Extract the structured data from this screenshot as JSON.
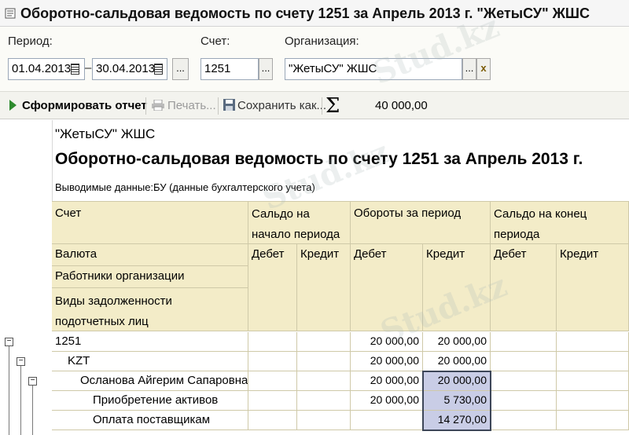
{
  "window": {
    "title": "Оборотно-сальдовая ведомость по счету 1251 за Апрель 2013 г. \"ЖетыСУ\" ЖШС"
  },
  "params": {
    "period_label": "Период:",
    "date_from": "01.04.2013",
    "dash": "–",
    "date_to": "30.04.2013",
    "ellipsis": "...",
    "account_label": "Счет:",
    "account": "1251",
    "org_label": "Организация:",
    "org": "\"ЖетыСУ\" ЖШС",
    "clear": "x"
  },
  "toolbar": {
    "generate": "Сформировать отчет",
    "print": "Печать...",
    "save": "Сохранить как...",
    "sigma": "Σ",
    "sum": "40 000,00"
  },
  "report": {
    "org": "\"ЖетыСУ\" ЖШС",
    "title": "Оборотно-сальдовая ведомость по счету 1251 за Апрель 2013 г.",
    "output_label": "Выводимые данные:",
    "output_value": "БУ (данные бухгалтерского учета)",
    "headers": {
      "account": "Счет",
      "opening": "Сальдо на",
      "opening2": "начало периода",
      "turnover": "Обороты за период",
      "closing": "Сальдо на конец",
      "closing2": "периода",
      "currency": "Валюта",
      "employees": "Работники организации",
      "debt_types": "Виды задолженности",
      "debt_types2": "подотчетных лиц",
      "debit": "Дебет",
      "credit": "Кредит"
    },
    "rows": [
      {
        "label": "1251",
        "debit": "20 000,00",
        "credit": "20 000,00"
      },
      {
        "label": "KZT",
        "debit": "20 000,00",
        "credit": "20 000,00"
      },
      {
        "label": "Осланова Айгерим Сапаровна",
        "debit": "20 000,00",
        "credit": "20 000,00"
      },
      {
        "label": "Приобретение активов",
        "debit": "20 000,00",
        "credit": "5 730,00"
      },
      {
        "label": "Оплата поставщикам",
        "debit": "",
        "credit": "14 270,00"
      }
    ],
    "tree_toggle": "−"
  },
  "watermark": "Stud.kz",
  "colors": {
    "header_bg": "#f3ecc8",
    "highlight": "#c9cde6",
    "accent_green": "#2e8b2e"
  }
}
